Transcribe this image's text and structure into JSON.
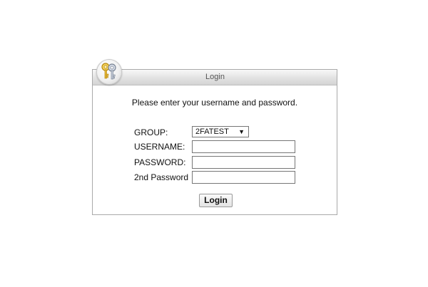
{
  "panel": {
    "title": "Login",
    "instructions": "Please enter your username and password.",
    "icon": "keys-icon"
  },
  "form": {
    "group_label": "GROUP:",
    "group_value": "2FATEST",
    "username_label": "USERNAME:",
    "username_value": "",
    "password_label": "PASSWORD:",
    "password_value": "",
    "second_password_label": "2nd Password",
    "second_password_value": ""
  },
  "actions": {
    "login_label": "Login"
  }
}
